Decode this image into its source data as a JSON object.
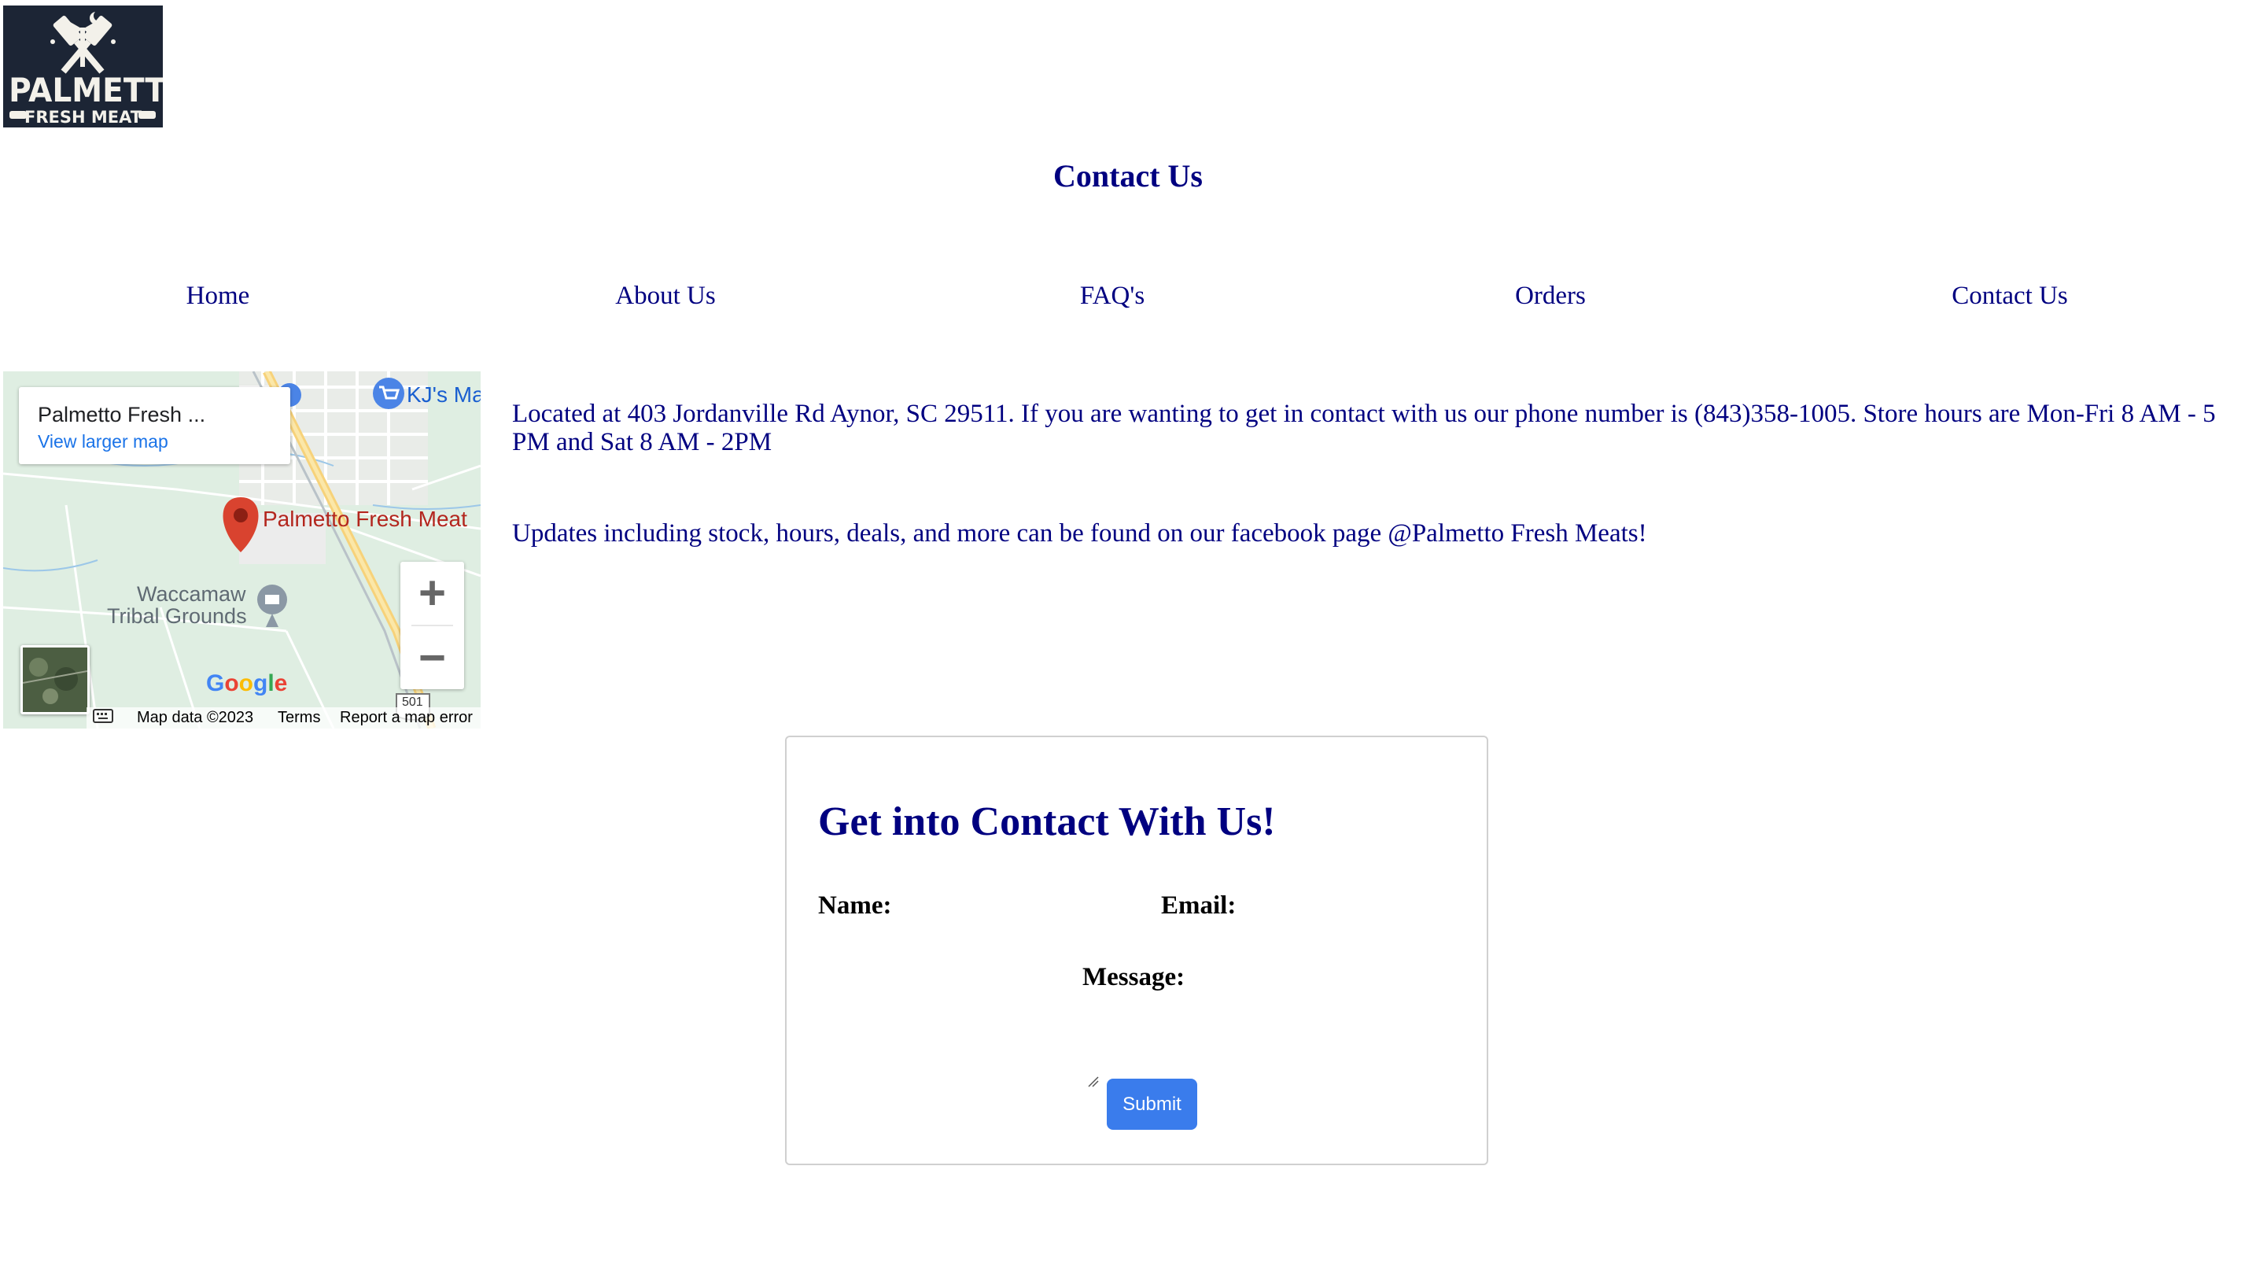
{
  "logo": {
    "line1": "PALMETTO",
    "line2": "FRESH MEAT",
    "colors": {
      "background": "#1c2535",
      "foreground": "#f3f1ea"
    }
  },
  "page_title": "Contact Us",
  "nav": {
    "items": [
      {
        "label": "Home"
      },
      {
        "label": "About Us"
      },
      {
        "label": "FAQ's"
      },
      {
        "label": "Orders"
      },
      {
        "label": "Contact Us"
      }
    ]
  },
  "map": {
    "place_name": "Palmetto Fresh ...",
    "view_larger_map": "View larger map",
    "pin_label": "Palmetto Fresh Meat",
    "store_label": "KJ's Ma",
    "landmark_line1": "Waccamaw",
    "landmark_line2": "Tribal Grounds",
    "zoom_in": "+",
    "zoom_out": "−",
    "google": "Google",
    "route_shield": "501",
    "footer": {
      "data": "Map data ©2023",
      "terms": "Terms",
      "report": "Report a map error"
    },
    "icons": [
      "map-pin-icon",
      "shopping-cart-icon",
      "landmark-icon",
      "keyboard-icon"
    ]
  },
  "info": {
    "paragraph1": "Located at 403 Jordanville Rd Aynor, SC 29511. If you are wanting to get in contact with us our phone number is (843)358-1005. Store hours are Mon-Fri 8 AM - 5 PM and Sat 8 AM - 2PM",
    "paragraph2": "Updates including stock, hours, deals, and more can be found on our facebook page @Palmetto Fresh Meats!"
  },
  "contact_form": {
    "heading": "Get into Contact With Us!",
    "name_label": "Name:",
    "email_label": "Email:",
    "message_label": "Message:",
    "submit_label": "Submit",
    "name_value": "",
    "email_value": "",
    "message_value": ""
  },
  "colors": {
    "text": "#000080",
    "submit_button": "#3a7cec",
    "map_land": "#dfeee2",
    "pin": "#d9432f"
  }
}
